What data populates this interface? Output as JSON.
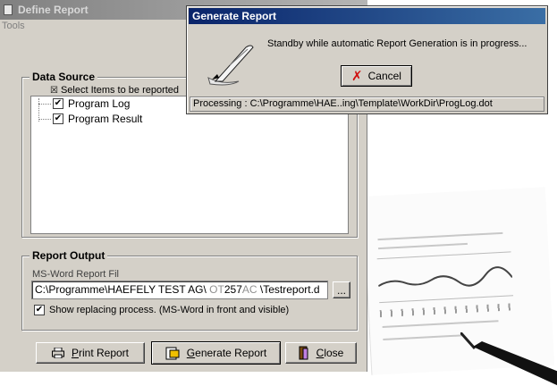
{
  "define_window": {
    "title": "Define Report",
    "menu_tools": "Tools",
    "data_source": {
      "title": "Data Source",
      "select_items_label": "Select Items to be reported",
      "items": [
        {
          "label": "Program Log",
          "checked": true
        },
        {
          "label": "Program Result",
          "checked": true
        }
      ]
    },
    "report_output": {
      "title": "Report Output",
      "file_label": "MS-Word Report Fil",
      "path_prefix": "C:\\Programme\\HAEFELY TEST AG\\",
      "path_dim1": " OT",
      "path_mid": "257",
      "path_dim2": "AC",
      "path_suffix": " \\Testreport.d",
      "browse_label": "...",
      "show_replacing_label": "Show replacing process. (MS-Word in front and visible)",
      "show_replacing_checked": true
    },
    "buttons": {
      "print_pre": "",
      "print_ul": "P",
      "print_post": "rint Report",
      "generate_ul": "G",
      "generate_post": "enerate Report",
      "close_ul": "C",
      "close_post": "lose"
    }
  },
  "generate_dialog": {
    "title": "Generate Report",
    "message": "Standby while automatic Report Generation is in progress...",
    "cancel_label": "Cancel",
    "status": "Processing : C:\\Programme\\HAE..ing\\Template\\WorkDir\\ProgLog.dot"
  },
  "colors": {
    "title_active": "#0a246a",
    "title_inactive": "#808080",
    "face": "#d4d0c8",
    "cancel_x": "#d01010"
  },
  "icons": [
    "window-icon",
    "quill-icon",
    "cancel-x-icon",
    "printer-icon",
    "generate-icon",
    "close-door-icon",
    "pen-icon"
  ]
}
